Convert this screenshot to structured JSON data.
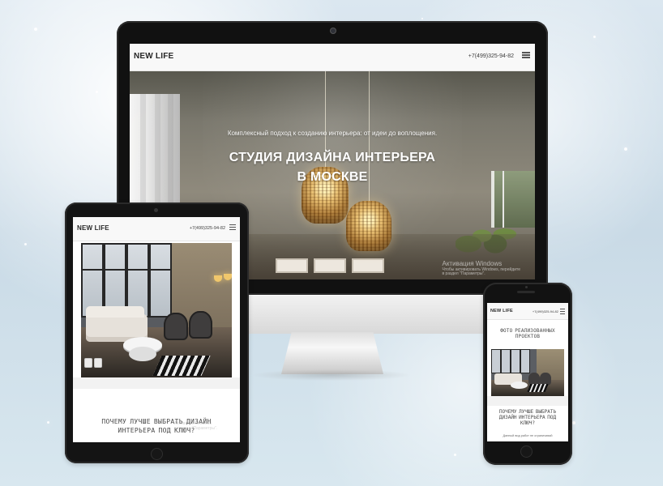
{
  "desktop": {
    "brand": "NEW LIFE",
    "phone": "+7(499)325-94-82",
    "hero_subtitle": "Комплексный подход к созданию интерьера: от идеи до воплощения.",
    "hero_title_line1": "СТУДИЯ ДИЗАЙНА ИНТЕРЬЕРА",
    "hero_title_line2": "В МОСКВЕ",
    "watermark_line1": "Активация Windows",
    "watermark_line2": "Чтобы активировать Windows, перейдите",
    "watermark_line3": "в раздел \"Параметры\"."
  },
  "tablet": {
    "brand": "NEW LIFE",
    "phone": "+7(499)325-94-82",
    "section_title": "ПОЧЕМУ ЛУЧШЕ ВЫБРАТЬ ДИЗАЙН ИНТЕРЬЕРА ПОД КЛЮЧ?",
    "watermark_line1": "Активация Windows",
    "watermark_line2": "в раздел \"Параметры\"."
  },
  "phone": {
    "brand": "NEW LIFE",
    "phone": "+7(499)325-94-82",
    "projects_title": "ФОТО РЕАЛИЗОВАННЫХ ПРОЕКТОВ",
    "question_title": "ПОЧЕМУ ЛУЧШЕ ВЫБРАТЬ ДИЗАЙН ИНТЕРЬЕРА ПОД КЛЮЧ?",
    "caption": "Данный вид работ не ограничивай"
  },
  "icons": {
    "menu": "hamburger-menu-icon",
    "apple": "apple-logo-icon",
    "tablet_controls": "gallery-controls-icon"
  },
  "colors": {
    "header_bg": "#f8f8f8",
    "hero_text": "#ffffff",
    "device_black": "#121212"
  }
}
